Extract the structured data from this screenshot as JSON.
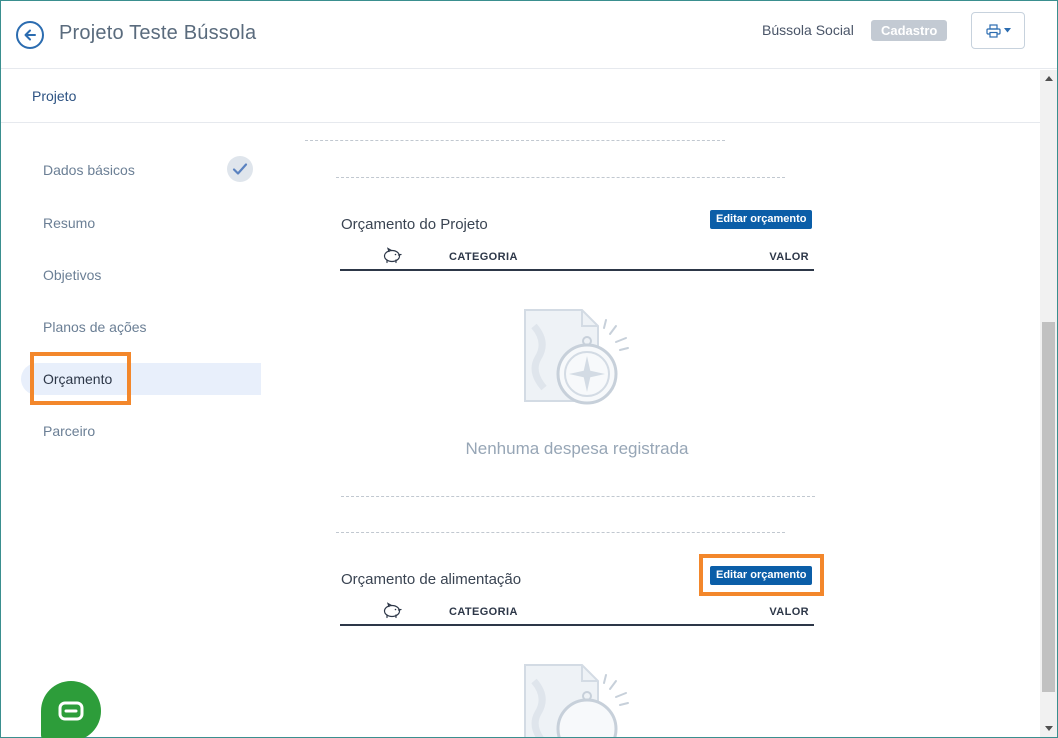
{
  "header": {
    "title": "Projeto Teste Bússola",
    "org_name": "Bússola Social",
    "status_badge": "Cadastro"
  },
  "breadcrumb": "Projeto",
  "sidebar": {
    "items": [
      {
        "label": "Dados básicos",
        "completed": true
      },
      {
        "label": "Resumo"
      },
      {
        "label": "Objetivos"
      },
      {
        "label": "Planos de ações"
      },
      {
        "label": "Orçamento",
        "active": true
      },
      {
        "label": "Parceiro"
      }
    ]
  },
  "sections": [
    {
      "title": "Orçamento do Projeto",
      "edit_label": "Editar orçamento",
      "columns": {
        "category": "CATEGORIA",
        "value": "VALOR"
      },
      "empty_text": "Nenhuma despesa registrada"
    },
    {
      "title": "Orçamento de alimentação",
      "edit_label": "Editar orçamento",
      "columns": {
        "category": "CATEGORIA",
        "value": "VALOR"
      }
    }
  ],
  "colors": {
    "accent": "#0b5ea8",
    "highlight": "#f3872b",
    "chat": "#2d9d3a"
  }
}
